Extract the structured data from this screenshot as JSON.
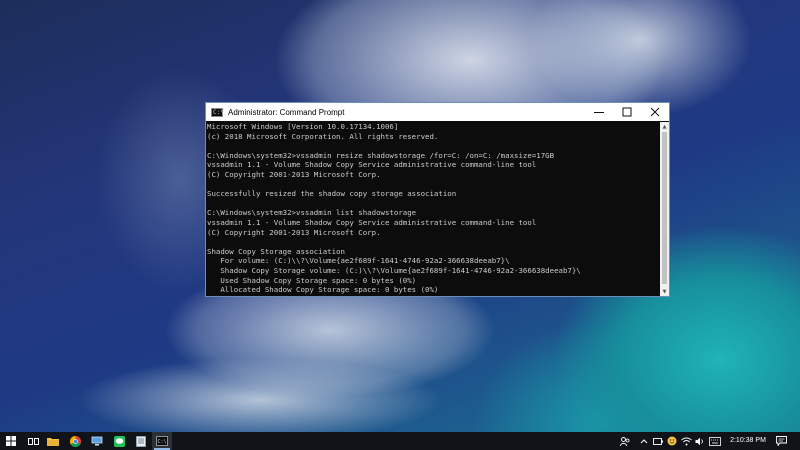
{
  "window": {
    "title": "Administrator: Command Prompt",
    "app_icon_glyph": "C:\\",
    "controls": {
      "minimize": "—",
      "maximize": "☐",
      "close": "✕"
    }
  },
  "console": {
    "lines": [
      "Microsoft Windows [Version 10.0.17134.1006]",
      "(c) 2018 Microsoft Corporation. All rights reserved.",
      "",
      "C:\\Windows\\system32>vssadmin resize shadowstorage /for=C: /on=C: /maxsize=17GB",
      "vssadmin 1.1 - Volume Shadow Copy Service administrative command-line tool",
      "(C) Copyright 2001-2013 Microsoft Corp.",
      "",
      "Successfully resized the shadow copy storage association",
      "",
      "C:\\Windows\\system32>vssadmin list shadowstorage",
      "vssadmin 1.1 - Volume Shadow Copy Service administrative command-line tool",
      "(C) Copyright 2001-2013 Microsoft Corp.",
      "",
      "Shadow Copy Storage association",
      "   For volume: (C:)\\\\?\\Volume{ae2f689f-1641-4746-92a2-366638deeab7}\\",
      "   Shadow Copy Storage volume: (C:)\\\\?\\Volume{ae2f689f-1641-4746-92a2-366638deeab7}\\",
      "   Used Shadow Copy Storage space: 0 bytes (0%)",
      "   Allocated Shadow Copy Storage space: 0 bytes (0%)"
    ]
  },
  "taskbar": {
    "clock": "2:10:38 PM",
    "apps": [
      {
        "name": "start",
        "icon": "windows-logo-icon"
      },
      {
        "name": "task-view",
        "icon": "task-view-icon"
      },
      {
        "name": "file-explorer",
        "icon": "folder-icon"
      },
      {
        "name": "chrome",
        "icon": "chrome-icon"
      },
      {
        "name": "network-app",
        "icon": "computer-icon"
      },
      {
        "name": "line",
        "icon": "chat-icon"
      },
      {
        "name": "document",
        "icon": "document-icon"
      },
      {
        "name": "command-prompt",
        "icon": "cmd-icon",
        "active": true
      }
    ],
    "accent_color": "#8fb8e8"
  },
  "colors": {
    "console_bg": "#0c0c0c",
    "console_fg": "#cccccc",
    "taskbar_bg": "#101418"
  }
}
